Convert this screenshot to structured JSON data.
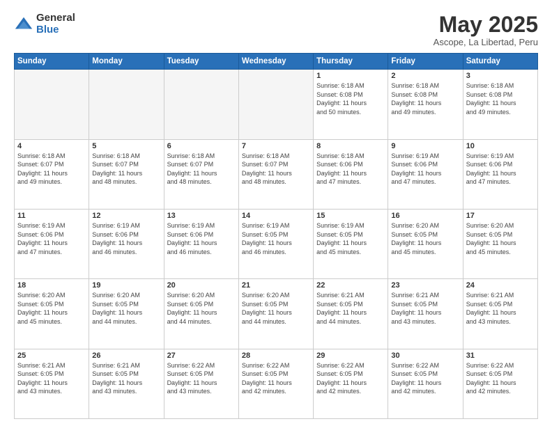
{
  "logo": {
    "general": "General",
    "blue": "Blue"
  },
  "header": {
    "month": "May 2025",
    "location": "Ascope, La Libertad, Peru"
  },
  "weekdays": [
    "Sunday",
    "Monday",
    "Tuesday",
    "Wednesday",
    "Thursday",
    "Friday",
    "Saturday"
  ],
  "weeks": [
    [
      {
        "day": "",
        "info": ""
      },
      {
        "day": "",
        "info": ""
      },
      {
        "day": "",
        "info": ""
      },
      {
        "day": "",
        "info": ""
      },
      {
        "day": "1",
        "info": "Sunrise: 6:18 AM\nSunset: 6:08 PM\nDaylight: 11 hours\nand 50 minutes."
      },
      {
        "day": "2",
        "info": "Sunrise: 6:18 AM\nSunset: 6:08 PM\nDaylight: 11 hours\nand 49 minutes."
      },
      {
        "day": "3",
        "info": "Sunrise: 6:18 AM\nSunset: 6:08 PM\nDaylight: 11 hours\nand 49 minutes."
      }
    ],
    [
      {
        "day": "4",
        "info": "Sunrise: 6:18 AM\nSunset: 6:07 PM\nDaylight: 11 hours\nand 49 minutes."
      },
      {
        "day": "5",
        "info": "Sunrise: 6:18 AM\nSunset: 6:07 PM\nDaylight: 11 hours\nand 48 minutes."
      },
      {
        "day": "6",
        "info": "Sunrise: 6:18 AM\nSunset: 6:07 PM\nDaylight: 11 hours\nand 48 minutes."
      },
      {
        "day": "7",
        "info": "Sunrise: 6:18 AM\nSunset: 6:07 PM\nDaylight: 11 hours\nand 48 minutes."
      },
      {
        "day": "8",
        "info": "Sunrise: 6:18 AM\nSunset: 6:06 PM\nDaylight: 11 hours\nand 47 minutes."
      },
      {
        "day": "9",
        "info": "Sunrise: 6:19 AM\nSunset: 6:06 PM\nDaylight: 11 hours\nand 47 minutes."
      },
      {
        "day": "10",
        "info": "Sunrise: 6:19 AM\nSunset: 6:06 PM\nDaylight: 11 hours\nand 47 minutes."
      }
    ],
    [
      {
        "day": "11",
        "info": "Sunrise: 6:19 AM\nSunset: 6:06 PM\nDaylight: 11 hours\nand 47 minutes."
      },
      {
        "day": "12",
        "info": "Sunrise: 6:19 AM\nSunset: 6:06 PM\nDaylight: 11 hours\nand 46 minutes."
      },
      {
        "day": "13",
        "info": "Sunrise: 6:19 AM\nSunset: 6:06 PM\nDaylight: 11 hours\nand 46 minutes."
      },
      {
        "day": "14",
        "info": "Sunrise: 6:19 AM\nSunset: 6:05 PM\nDaylight: 11 hours\nand 46 minutes."
      },
      {
        "day": "15",
        "info": "Sunrise: 6:19 AM\nSunset: 6:05 PM\nDaylight: 11 hours\nand 45 minutes."
      },
      {
        "day": "16",
        "info": "Sunrise: 6:20 AM\nSunset: 6:05 PM\nDaylight: 11 hours\nand 45 minutes."
      },
      {
        "day": "17",
        "info": "Sunrise: 6:20 AM\nSunset: 6:05 PM\nDaylight: 11 hours\nand 45 minutes."
      }
    ],
    [
      {
        "day": "18",
        "info": "Sunrise: 6:20 AM\nSunset: 6:05 PM\nDaylight: 11 hours\nand 45 minutes."
      },
      {
        "day": "19",
        "info": "Sunrise: 6:20 AM\nSunset: 6:05 PM\nDaylight: 11 hours\nand 44 minutes."
      },
      {
        "day": "20",
        "info": "Sunrise: 6:20 AM\nSunset: 6:05 PM\nDaylight: 11 hours\nand 44 minutes."
      },
      {
        "day": "21",
        "info": "Sunrise: 6:20 AM\nSunset: 6:05 PM\nDaylight: 11 hours\nand 44 minutes."
      },
      {
        "day": "22",
        "info": "Sunrise: 6:21 AM\nSunset: 6:05 PM\nDaylight: 11 hours\nand 44 minutes."
      },
      {
        "day": "23",
        "info": "Sunrise: 6:21 AM\nSunset: 6:05 PM\nDaylight: 11 hours\nand 43 minutes."
      },
      {
        "day": "24",
        "info": "Sunrise: 6:21 AM\nSunset: 6:05 PM\nDaylight: 11 hours\nand 43 minutes."
      }
    ],
    [
      {
        "day": "25",
        "info": "Sunrise: 6:21 AM\nSunset: 6:05 PM\nDaylight: 11 hours\nand 43 minutes."
      },
      {
        "day": "26",
        "info": "Sunrise: 6:21 AM\nSunset: 6:05 PM\nDaylight: 11 hours\nand 43 minutes."
      },
      {
        "day": "27",
        "info": "Sunrise: 6:22 AM\nSunset: 6:05 PM\nDaylight: 11 hours\nand 43 minutes."
      },
      {
        "day": "28",
        "info": "Sunrise: 6:22 AM\nSunset: 6:05 PM\nDaylight: 11 hours\nand 42 minutes."
      },
      {
        "day": "29",
        "info": "Sunrise: 6:22 AM\nSunset: 6:05 PM\nDaylight: 11 hours\nand 42 minutes."
      },
      {
        "day": "30",
        "info": "Sunrise: 6:22 AM\nSunset: 6:05 PM\nDaylight: 11 hours\nand 42 minutes."
      },
      {
        "day": "31",
        "info": "Sunrise: 6:22 AM\nSunset: 6:05 PM\nDaylight: 11 hours\nand 42 minutes."
      }
    ]
  ]
}
